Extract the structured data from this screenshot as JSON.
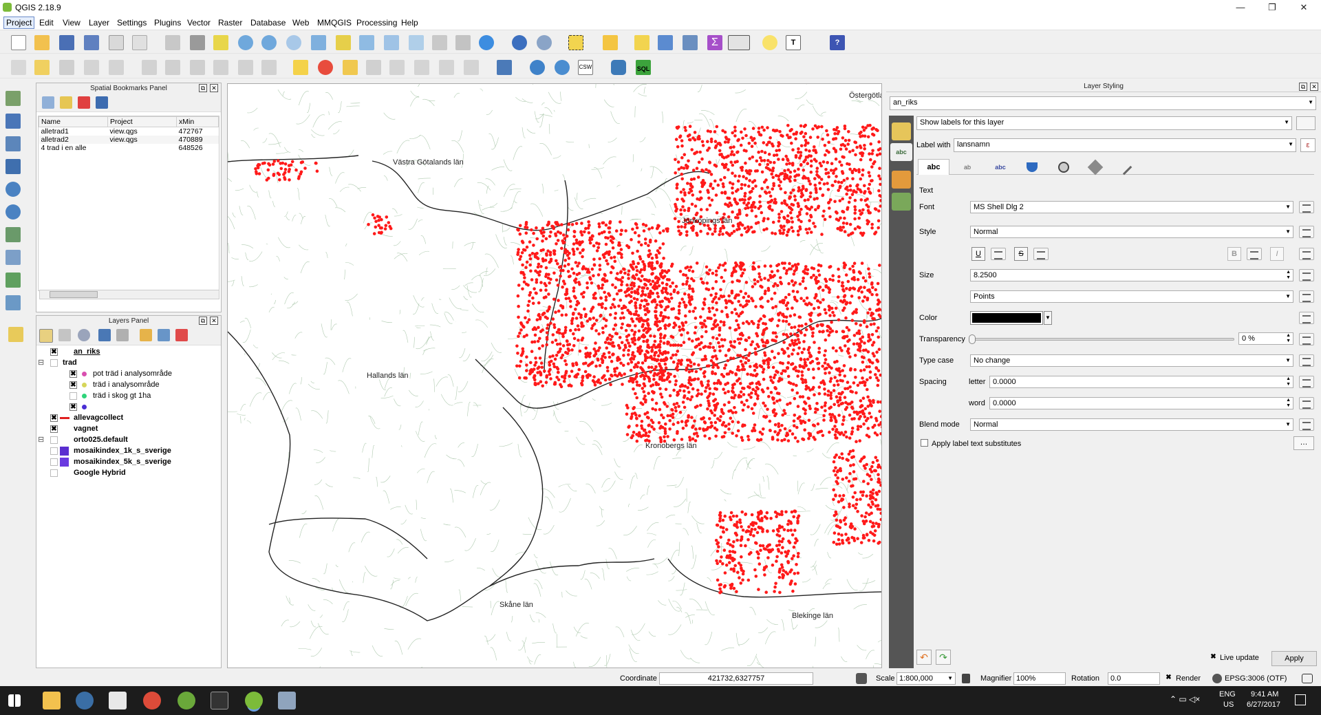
{
  "window": {
    "title": "QGIS 2.18.9"
  },
  "menu": [
    "Project",
    "Edit",
    "View",
    "Layer",
    "Settings",
    "Plugins",
    "Vector",
    "Raster",
    "Database",
    "Web",
    "MMQGIS",
    "Processing",
    "Help"
  ],
  "bookmarks": {
    "title": "Spatial Bookmarks Panel",
    "columns": [
      "Name",
      "Project",
      "xMin"
    ],
    "rows": [
      [
        "alletrad1",
        "view.qgs",
        "472767"
      ],
      [
        "alletrad2",
        "view.qgs",
        "470889"
      ],
      [
        "4 trad i en alle",
        "",
        "648526"
      ]
    ]
  },
  "layers": {
    "title": "Layers Panel",
    "items": [
      {
        "label": "an_riks",
        "checked": "✖",
        "bold": true,
        "indent": 0
      },
      {
        "label": "trad",
        "checked": "",
        "bold": true,
        "indent": 0,
        "group": "⊟"
      },
      {
        "label": "pot träd i analysområde",
        "checked": "✖",
        "bold": false,
        "indent": 1,
        "color": "#d94fb0"
      },
      {
        "label": "träd i analysområde",
        "checked": "✖",
        "bold": false,
        "indent": 1,
        "color": "#d6d65a"
      },
      {
        "label": "träd i skog gt 1ha",
        "checked": "",
        "bold": false,
        "indent": 1,
        "color": "#2ed47a"
      },
      {
        "label": "",
        "checked": "✖",
        "bold": false,
        "indent": 1,
        "color": "#4a2ed4"
      },
      {
        "label": "allevagcollect",
        "checked": "✖",
        "bold": true,
        "indent": 0,
        "line": "#e02020"
      },
      {
        "label": "vagnet",
        "checked": "✖",
        "bold": true,
        "indent": 0
      },
      {
        "label": "orto025.default",
        "checked": "",
        "bold": true,
        "indent": 0,
        "group": "⊟"
      },
      {
        "label": "mosaikindex_1k_s_sverige",
        "checked": "",
        "bold": true,
        "indent": 0,
        "swatch": "#5a2ed0"
      },
      {
        "label": "mosaikindex_5k_s_sverige",
        "checked": "",
        "bold": true,
        "indent": 0,
        "swatch": "#6a3ae0"
      },
      {
        "label": "Google Hybrid",
        "checked": "",
        "bold": true,
        "indent": 0
      }
    ]
  },
  "map": {
    "labels": [
      "Västra Götalands län",
      "Östergötla",
      "Jönköpings län",
      "Hallands län",
      "Kronobergs län",
      "Skåne län",
      "Blekinge län"
    ]
  },
  "styling": {
    "title": "Layer Styling",
    "layer": "an_riks",
    "mode": "Show labels for this layer",
    "label_with_caption": "Label with",
    "label_field": "lansnamn",
    "section": "Text",
    "font_label": "Font",
    "font": "MS Shell Dlg 2",
    "style_label": "Style",
    "style": "Normal",
    "size_label": "Size",
    "size": "8.2500",
    "units": "Points",
    "color_label": "Color",
    "transparency_label": "Transparency",
    "transparency": "0 %",
    "typecase_label": "Type case",
    "typecase": "No change",
    "spacing_label": "Spacing",
    "letter_label": "letter",
    "letter": "0.0000",
    "word_label": "word",
    "word": "0.0000",
    "blend_label": "Blend mode",
    "blend": "Normal",
    "substitutes": "Apply label text substitutes",
    "live_update": "Live update",
    "apply": "Apply",
    "tabs": [
      "abc",
      "ab",
      "abc",
      "",
      "",
      "",
      ""
    ],
    "fmt_buttons": [
      "U",
      "S",
      "B",
      "I"
    ]
  },
  "status": {
    "coordinate_label": "Coordinate",
    "coordinate": "421732,6327757",
    "scale_label": "Scale",
    "scale": "1:800,000",
    "magnifier_label": "Magnifier",
    "magnifier": "100%",
    "rotation_label": "Rotation",
    "rotation": "0.0",
    "render": "Render",
    "crs": "EPSG:3006 (OTF)"
  },
  "taskbar": {
    "lang": "ENG",
    "region": "US",
    "time": "9:41 AM",
    "date": "6/27/2017"
  },
  "colors": {
    "points": "#ff1a1a",
    "roads": "#6e9f6e",
    "border": "#222222"
  }
}
